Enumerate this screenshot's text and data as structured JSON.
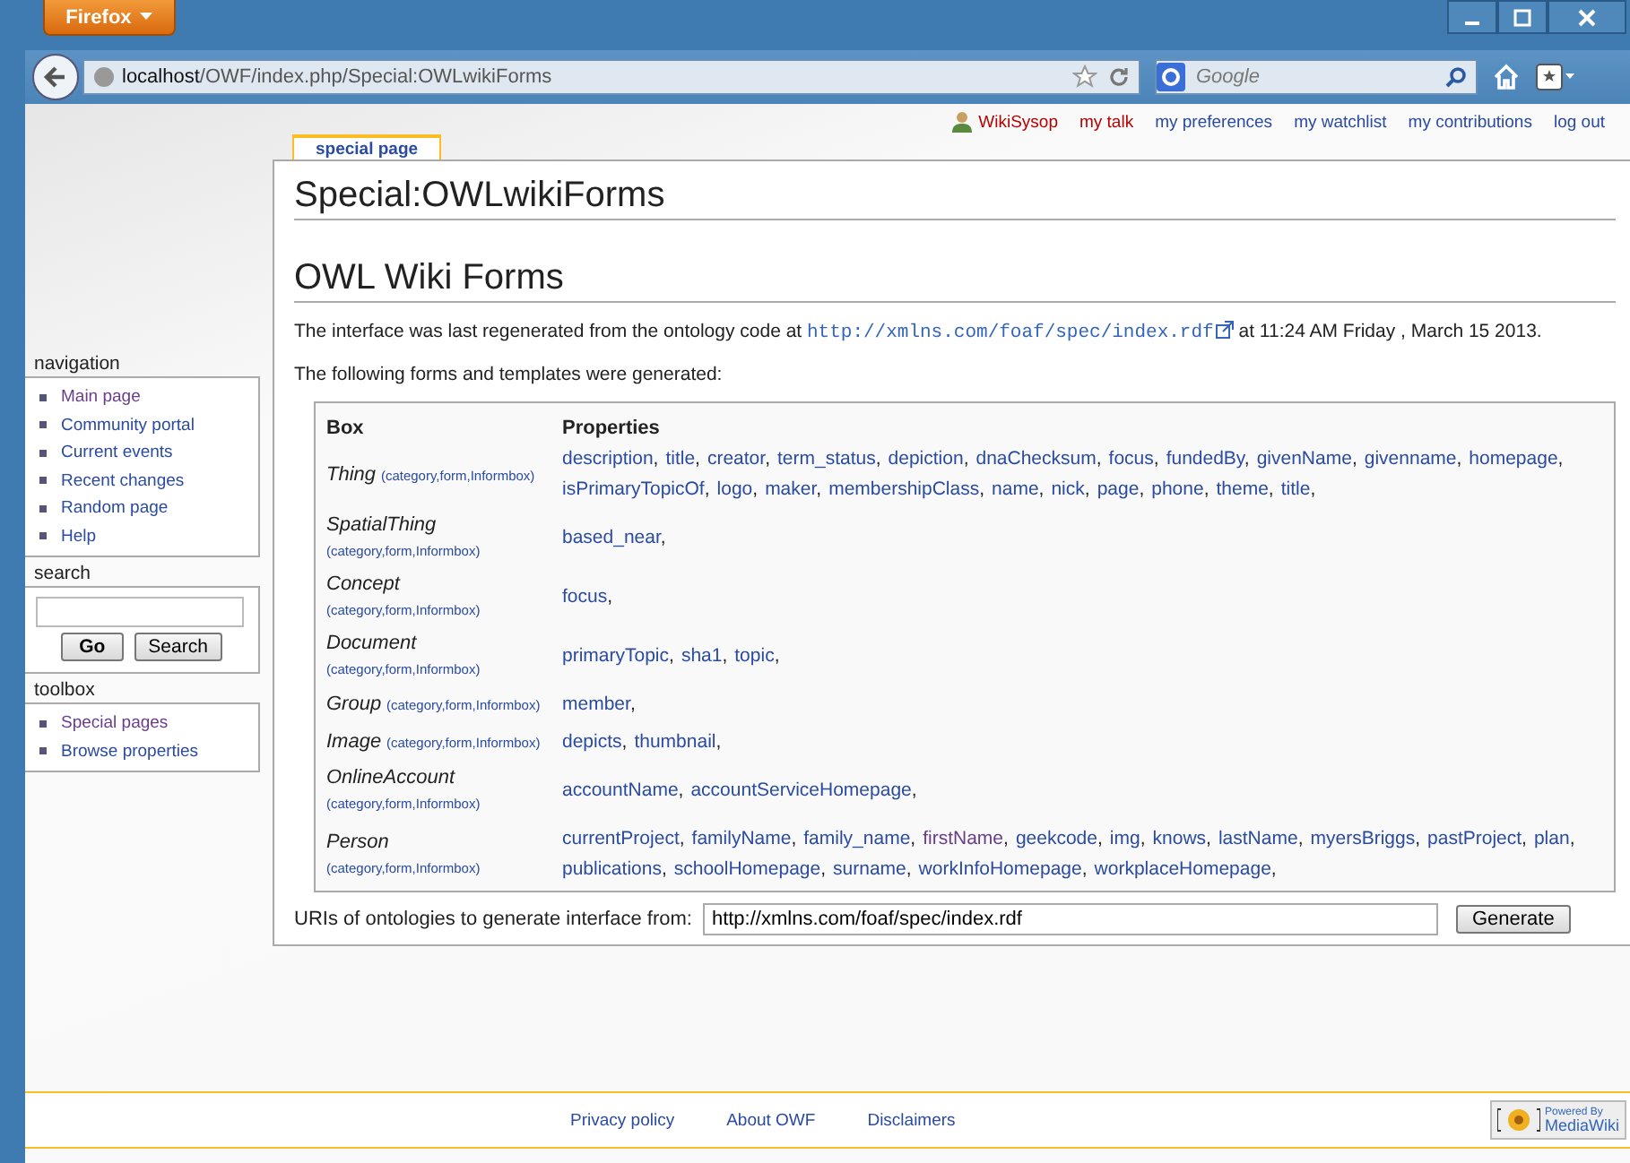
{
  "browser": {
    "menu_button": "Firefox",
    "address": {
      "host": "localhost",
      "path": "/OWF/index.php/Special:OWLwikiForms"
    },
    "search_placeholder": "Google"
  },
  "personal_tools": [
    {
      "label": "WikiSysop",
      "kind": "user",
      "new": true
    },
    {
      "label": "my talk",
      "kind": "link",
      "new": true
    },
    {
      "label": "my preferences",
      "kind": "link",
      "new": false
    },
    {
      "label": "my watchlist",
      "kind": "link",
      "new": false
    },
    {
      "label": "my contributions",
      "kind": "link",
      "new": false
    },
    {
      "label": "log out",
      "kind": "link",
      "new": false
    }
  ],
  "tab": {
    "label": "special page",
    "selected": true
  },
  "sidebar": {
    "navigation": {
      "title": "navigation",
      "items": [
        {
          "label": "Main page",
          "visited": true
        },
        {
          "label": "Community portal",
          "visited": false
        },
        {
          "label": "Current events",
          "visited": false
        },
        {
          "label": "Recent changes",
          "visited": false
        },
        {
          "label": "Random page",
          "visited": false
        },
        {
          "label": "Help",
          "visited": false
        }
      ]
    },
    "search": {
      "title": "search",
      "buttons": [
        "Go",
        "Search"
      ]
    },
    "toolbox": {
      "title": "toolbox",
      "items": [
        {
          "label": "Special pages",
          "visited": true
        },
        {
          "label": "Browse properties",
          "visited": false
        }
      ]
    }
  },
  "page_title": "Special:OWLwikiForms",
  "heading": "OWL Wiki Forms",
  "intro": {
    "before": "The interface was last regenerated from the ontology code at",
    "link": "http://xmlns.com/foaf/spec/index.rdf",
    "after": "at 11:24 AM Friday , March 15 2013."
  },
  "generated_note": "The following forms and templates were generated:",
  "table": {
    "columns": [
      "Box",
      "Properties"
    ],
    "separator": ",",
    "rows": [
      {
        "box": "Thing",
        "links": "(category,form,Informbox)",
        "properties": [
          {
            "name": "description",
            "visited": false
          },
          {
            "name": "title",
            "visited": false
          },
          {
            "name": "creator",
            "visited": false
          },
          {
            "name": "term_status",
            "visited": false
          },
          {
            "name": "depiction",
            "visited": false
          },
          {
            "name": "dnaChecksum",
            "visited": false
          },
          {
            "name": "focus",
            "visited": false
          },
          {
            "name": "fundedBy",
            "visited": false
          },
          {
            "name": "givenName",
            "visited": false
          },
          {
            "name": "givenname",
            "visited": false
          },
          {
            "name": "homepage",
            "visited": false
          },
          {
            "name": "isPrimaryTopicOf",
            "visited": false
          },
          {
            "name": "logo",
            "visited": false
          },
          {
            "name": "maker",
            "visited": false
          },
          {
            "name": "membershipClass",
            "visited": false
          },
          {
            "name": "name",
            "visited": false
          },
          {
            "name": "nick",
            "visited": false
          },
          {
            "name": "page",
            "visited": false
          },
          {
            "name": "phone",
            "visited": false
          },
          {
            "name": "theme",
            "visited": false
          },
          {
            "name": "title",
            "visited": false
          }
        ]
      },
      {
        "box": "SpatialThing",
        "links": "(category,form,Informbox)",
        "properties": [
          {
            "name": "based_near",
            "visited": false
          }
        ]
      },
      {
        "box": "Concept",
        "links": "(category,form,Informbox)",
        "properties": [
          {
            "name": "focus",
            "visited": false
          }
        ]
      },
      {
        "box": "Document",
        "links": "(category,form,Informbox)",
        "properties": [
          {
            "name": "primaryTopic",
            "visited": false
          },
          {
            "name": "sha1",
            "visited": false
          },
          {
            "name": "topic",
            "visited": false
          }
        ]
      },
      {
        "box": "Group",
        "links": "(category,form,Informbox)",
        "properties": [
          {
            "name": "member",
            "visited": false
          }
        ]
      },
      {
        "box": "Image",
        "links": "(category,form,Informbox)",
        "properties": [
          {
            "name": "depicts",
            "visited": false
          },
          {
            "name": "thumbnail",
            "visited": false
          }
        ]
      },
      {
        "box": "OnlineAccount",
        "links": "(category,form,Informbox)",
        "properties": [
          {
            "name": "accountName",
            "visited": false
          },
          {
            "name": "accountServiceHomepage",
            "visited": false
          }
        ]
      },
      {
        "box": "Person",
        "links": "(category,form,Informbox)",
        "properties": [
          {
            "name": "currentProject",
            "visited": false
          },
          {
            "name": "familyName",
            "visited": false
          },
          {
            "name": "family_name",
            "visited": false
          },
          {
            "name": "firstName",
            "visited": true
          },
          {
            "name": "geekcode",
            "visited": false
          },
          {
            "name": "img",
            "visited": false
          },
          {
            "name": "knows",
            "visited": false
          },
          {
            "name": "lastName",
            "visited": false
          },
          {
            "name": "myersBriggs",
            "visited": false
          },
          {
            "name": "pastProject",
            "visited": false
          },
          {
            "name": "plan",
            "visited": false
          },
          {
            "name": "publications",
            "visited": false
          },
          {
            "name": "schoolHomepage",
            "visited": false
          },
          {
            "name": "surname",
            "visited": false
          },
          {
            "name": "workInfoHomepage",
            "visited": false
          },
          {
            "name": "workplaceHomepage",
            "visited": false
          }
        ]
      }
    ]
  },
  "generate_form": {
    "label": "URIs of ontologies to generate interface from:",
    "value": "http://xmlns.com/foaf/spec/index.rdf",
    "button": "Generate"
  },
  "footer": {
    "links": [
      "Privacy policy",
      "About OWF",
      "Disclaimers"
    ],
    "badge": {
      "top": "Powered By",
      "bottom": "MediaWiki"
    }
  }
}
